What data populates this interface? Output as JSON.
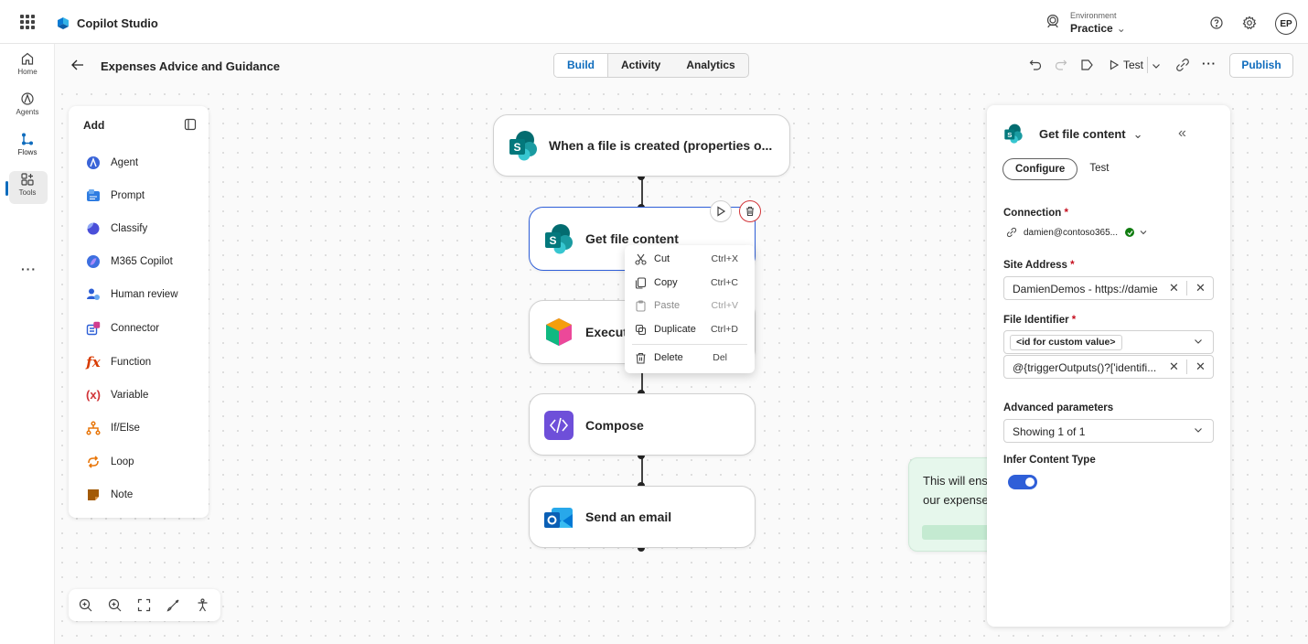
{
  "app": {
    "name": "Copilot Studio"
  },
  "environment": {
    "label": "Environment",
    "value": "Practice",
    "chevron": "⌄"
  },
  "user": {
    "initials": "EP"
  },
  "rail": {
    "items": [
      {
        "label": "Home"
      },
      {
        "label": "Agents"
      },
      {
        "label": "Flows"
      },
      {
        "label": "Tools"
      }
    ],
    "more": "···"
  },
  "header": {
    "title": "Expenses Advice and Guidance",
    "tabs": [
      {
        "label": "Build"
      },
      {
        "label": "Activity"
      },
      {
        "label": "Analytics"
      }
    ],
    "test_label": "Test",
    "more": "···",
    "publish_label": "Publish"
  },
  "add_panel": {
    "title": "Add",
    "items": [
      {
        "label": "Agent"
      },
      {
        "label": "Prompt"
      },
      {
        "label": "Classify"
      },
      {
        "label": "M365 Copilot"
      },
      {
        "label": "Human review"
      },
      {
        "label": "Connector"
      },
      {
        "label": "Function"
      },
      {
        "label": "Variable"
      },
      {
        "label": "If/Else"
      },
      {
        "label": "Loop"
      },
      {
        "label": "Note"
      }
    ]
  },
  "flow": {
    "nodes": [
      {
        "label": "When a file is created (properties o..."
      },
      {
        "label": "Get file content"
      },
      {
        "label": "Execut"
      },
      {
        "label": "Compose"
      },
      {
        "label": "Send an email"
      }
    ]
  },
  "context_menu": {
    "items": [
      {
        "label": "Cut",
        "shortcut": "Ctrl+X"
      },
      {
        "label": "Copy",
        "shortcut": "Ctrl+C"
      },
      {
        "label": "Paste",
        "shortcut": "Ctrl+V",
        "disabled": true
      },
      {
        "label": "Duplicate",
        "shortcut": "Ctrl+D"
      },
      {
        "label": "Delete",
        "shortcut": "Del"
      }
    ]
  },
  "note": {
    "line1": "This will ens",
    "line2": "our expense"
  },
  "right_panel": {
    "title": "Get file content",
    "tabs": [
      {
        "label": "Configure"
      },
      {
        "label": "Test"
      }
    ],
    "connection": {
      "label": "Connection",
      "required": "*",
      "value": "damien@contoso365..."
    },
    "site_address": {
      "label": "Site Address",
      "required": "*",
      "value": "DamienDemos - https://damie"
    },
    "file_identifier": {
      "label": "File Identifier",
      "required": "*",
      "token": "<id for custom value>",
      "value": "@{triggerOutputs()?['identifi..."
    },
    "advanced": {
      "label": "Advanced parameters",
      "value": "Showing 1 of 1"
    },
    "infer": {
      "label": "Infer Content Type",
      "on": true
    }
  },
  "colors": {
    "accent": "#0f6cbd",
    "selected_border": "#2f5fd8",
    "delete_red": "#d13438",
    "note_bg": "#e6f7ec"
  }
}
